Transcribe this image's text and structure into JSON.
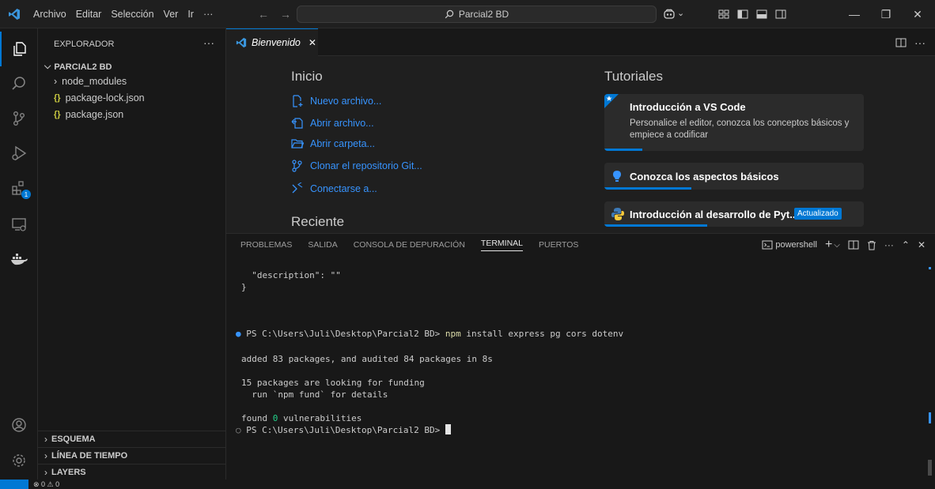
{
  "titlebar": {
    "menus": [
      "Archivo",
      "Editar",
      "Selección",
      "Ver",
      "Ir",
      "···"
    ],
    "search_text": "Parcial2 BD",
    "copilot_chevron": "⌄"
  },
  "sidebar": {
    "header": "EXPLORADOR",
    "more": "···",
    "root": "PARCIAL2 BD",
    "items": [
      {
        "label": "node_modules",
        "type": "folder"
      },
      {
        "label": "package-lock.json",
        "type": "json"
      },
      {
        "label": "package.json",
        "type": "json"
      }
    ],
    "sections": [
      "ESQUEMA",
      "LÍNEA DE TIEMPO",
      "LAYERS"
    ],
    "json_glyph": "{}"
  },
  "editor": {
    "tab_label": "Bienvenido",
    "tab_close": "✕",
    "more": "···",
    "welcome": {
      "start_title": "Inicio",
      "start_items": [
        "Nuevo archivo...",
        "Abrir archivo...",
        "Abrir carpeta...",
        "Clonar el repositorio Git...",
        "Conectarse a..."
      ],
      "recent_title": "Reciente",
      "tutorials_title": "Tutoriales",
      "tutorials": [
        {
          "title": "Introducción a VS Code",
          "desc": "Personalice el editor, conozca los conceptos básicos y empiece a codificar",
          "badge": ""
        },
        {
          "title": "Conozca los aspectos básicos",
          "desc": "",
          "badge": ""
        },
        {
          "title": "Introducción al desarrollo de Pyt...",
          "desc": "",
          "badge": "Actualizado"
        }
      ]
    }
  },
  "panel": {
    "tabs": [
      "PROBLEMAS",
      "SALIDA",
      "CONSOLA DE DEPURACIÓN",
      "TERMINAL",
      "PUERTOS"
    ],
    "active_tab": "TERMINAL",
    "shell": "powershell",
    "terminal": {
      "line1": "  \"description\": \"\"",
      "line2": "}",
      "prompt1_pre": "PS C:\\Users\\Juli\\Desktop\\Parcial2 BD> ",
      "prompt1_cmd": "npm",
      "prompt1_args": " install express pg cors dotenv",
      "out1": "added 83 packages, and audited 84 packages in 8s",
      "out2": "15 packages are looking for funding",
      "out3": "  run `npm fund` for details",
      "out4_pre": "found ",
      "out4_num": "0",
      "out4_post": " vulnerabilities",
      "prompt2": "PS C:\\Users\\Juli\\Desktop\\Parcial2 BD> "
    }
  },
  "statusbar": {
    "problems": "⊗ 0 ⚠ 0"
  },
  "colors": {
    "accent": "#0078d4",
    "link": "#3794ff",
    "npm_cmd": "#dcdcaa",
    "zero": "#23d18b"
  }
}
